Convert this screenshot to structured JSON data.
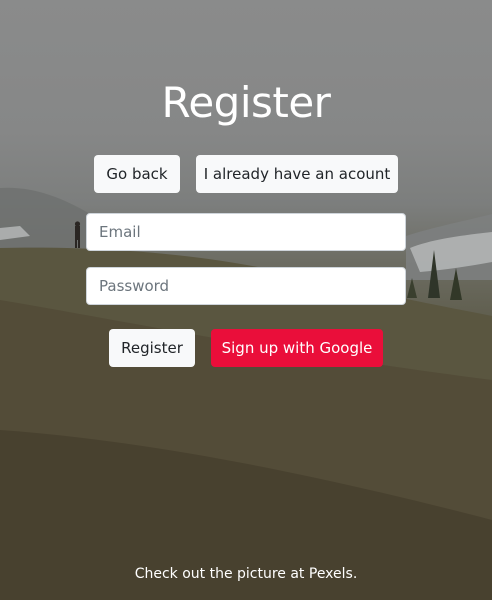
{
  "page": {
    "title": "Register",
    "credit": "Check out the picture at Pexels."
  },
  "nav": {
    "go_back_label": "Go back",
    "have_account_label": "I already have an acount"
  },
  "form": {
    "email_placeholder": "Email",
    "email_value": "",
    "password_placeholder": "Password",
    "password_value": ""
  },
  "actions": {
    "register_label": "Register",
    "google_label": "Sign up with Google"
  },
  "colors": {
    "google_button": "#ea0e3a",
    "light_button": "#f8f9fa",
    "title_text": "#ffffff"
  }
}
